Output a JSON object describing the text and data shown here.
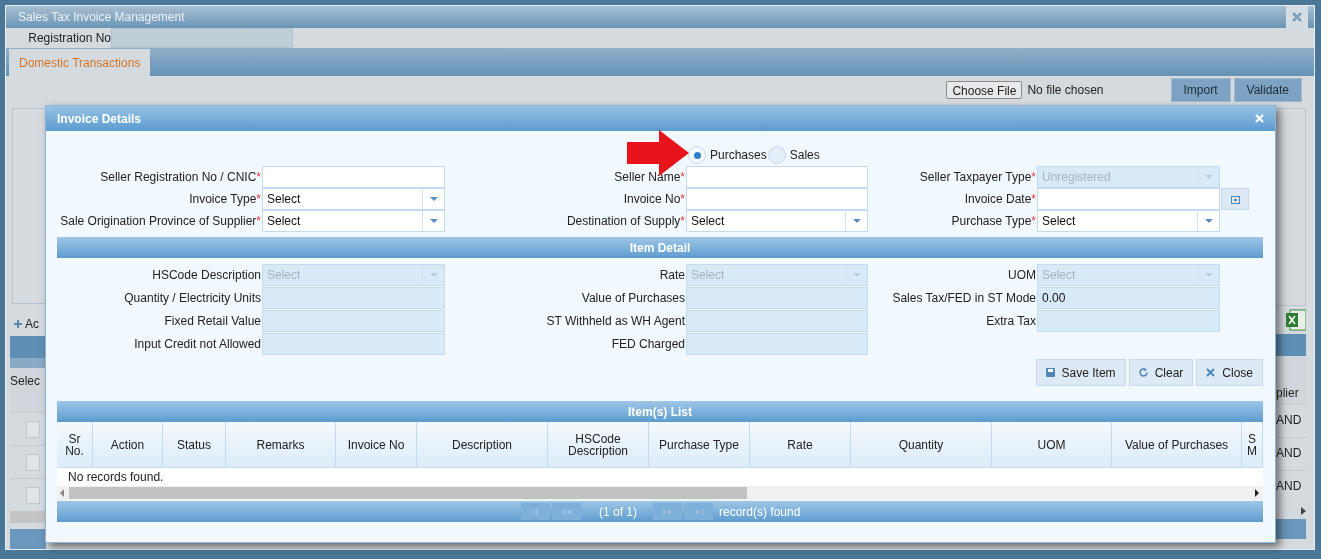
{
  "window": {
    "title": "Sales Tax Invoice Management"
  },
  "registration": {
    "label": "Registration No"
  },
  "tabs": [
    {
      "label": "Domestic Transactions",
      "selected": true
    }
  ],
  "file_upload": {
    "button": "Choose File",
    "status": "No file chosen"
  },
  "toolbar_buttons": [
    "Import",
    "Validate"
  ],
  "background_fragments": {
    "add_button": "Ac",
    "header_left": "Selec",
    "header_right": "plier",
    "rows": [
      {
        "checked": false,
        "value": "AND"
      },
      {
        "checked": false,
        "value": "AND"
      },
      {
        "checked": false,
        "value": "AND"
      }
    ]
  },
  "dialog": {
    "title": "Invoice Details",
    "mode_options": [
      {
        "label": "Purchases",
        "selected": true
      },
      {
        "label": "Sales",
        "selected": false
      }
    ],
    "header_rows": [
      [
        {
          "label": "Seller Registration No / CNIC",
          "mark": "*",
          "kind": "text",
          "disabled": false
        },
        {
          "label": "Seller Name",
          "mark": "*",
          "kind": "text",
          "disabled": false
        },
        {
          "label": "Seller Taxpayer Type",
          "mark": "*",
          "kind": "select",
          "value": "Unregistered",
          "disabled": true
        }
      ],
      [
        {
          "label": "Invoice Type",
          "mark": "*",
          "kind": "select",
          "value": "Select",
          "disabled": false
        },
        {
          "label": "Invoice No",
          "mark": "*",
          "kind": "text",
          "disabled": false
        },
        {
          "label": "Invoice Date",
          "mark": "*",
          "kind": "date",
          "disabled": false
        }
      ],
      [
        {
          "label": "Sale Origination Province of Supplier",
          "mark": "*",
          "kind": "select",
          "value": "Select",
          "disabled": false
        },
        {
          "label": "Destination of Supply",
          "mark": "*",
          "kind": "select",
          "value": "Select",
          "disabled": false
        },
        {
          "label": "Purchase Type",
          "mark": "*",
          "kind": "select",
          "value": "Select",
          "disabled": false
        }
      ]
    ],
    "item_detail": {
      "title": "Item Detail",
      "rows": [
        [
          {
            "label": "HSCode Description",
            "kind": "select",
            "value": "Select",
            "disabled": true
          },
          {
            "label": "Rate",
            "kind": "select",
            "value": "Select",
            "disabled": true
          },
          {
            "label": "UOM",
            "kind": "select",
            "value": "Select",
            "disabled": true
          }
        ],
        [
          {
            "label": "Quantity / Electricity Units",
            "kind": "text",
            "disabled": true
          },
          {
            "label": "Value of Purchases",
            "kind": "text",
            "disabled": true
          },
          {
            "label": "Sales Tax/FED in ST Mode",
            "kind": "text",
            "value": "0.00",
            "disabled": true
          }
        ],
        [
          {
            "label": "Fixed Retail Value",
            "kind": "text",
            "disabled": true
          },
          {
            "label": "ST Withheld as WH Agent",
            "kind": "text",
            "disabled": true
          },
          {
            "label": "Extra Tax",
            "kind": "text",
            "disabled": true
          }
        ],
        [
          {
            "label": "Input Credit not Allowed",
            "kind": "text",
            "disabled": true
          },
          {
            "label": "FED Charged",
            "kind": "text",
            "disabled": true
          }
        ]
      ]
    },
    "buttons": [
      {
        "label": "Save Item",
        "kind": "save"
      },
      {
        "label": "Clear",
        "kind": "clear"
      },
      {
        "label": "Close",
        "kind": "close"
      }
    ],
    "items_list": {
      "title": "Item(s) List",
      "columns": [
        "Sr No.",
        "Action",
        "Status",
        "Remarks",
        "Invoice No",
        "Description",
        "HSCode Description",
        "Purchase Type",
        "Rate",
        "Quantity",
        "UOM",
        "Value of Purchases",
        "S M"
      ],
      "empty_text": "No records found.",
      "page": "(1 of 1)",
      "summary": "record(s) found"
    }
  }
}
